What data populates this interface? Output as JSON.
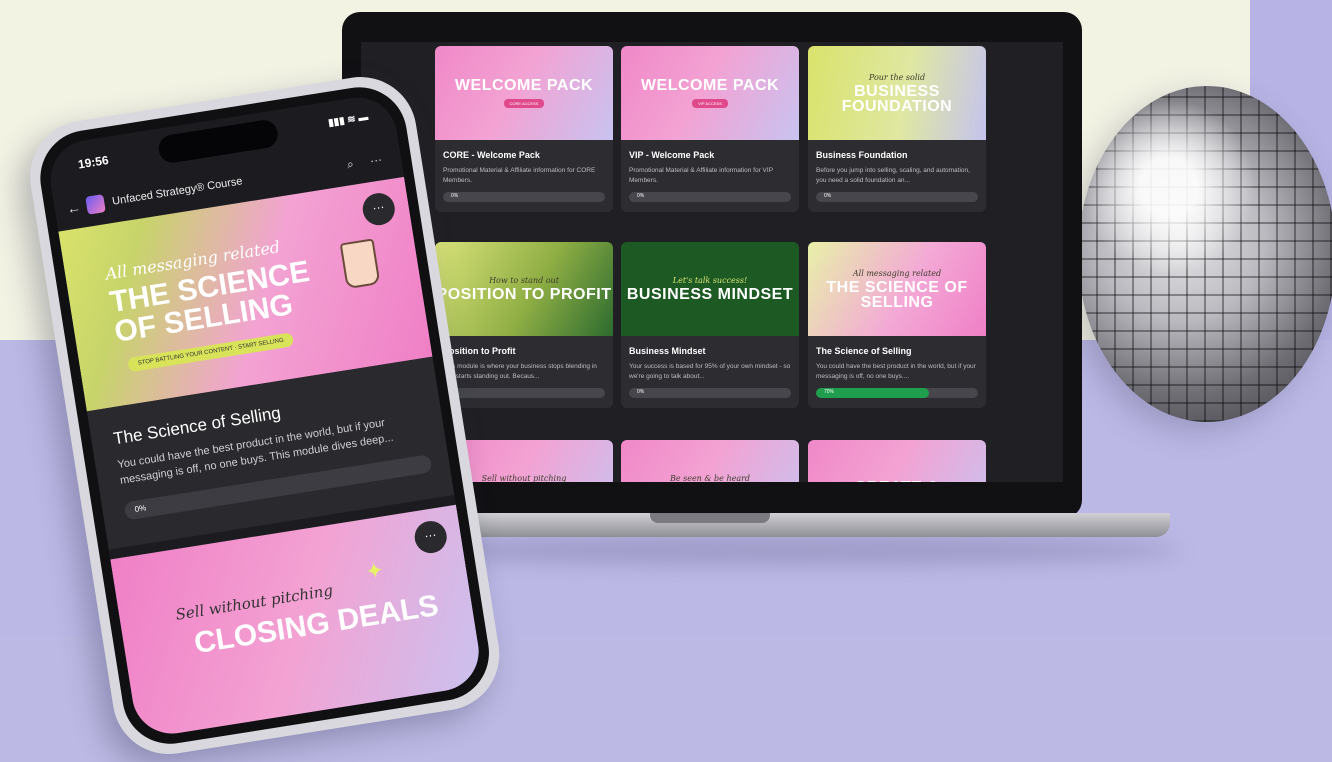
{
  "laptop": {
    "cards": [
      {
        "thumb_script": "",
        "thumb_title": "WELCOME PACK",
        "thumb_pill": "CORE ACCESS",
        "title": "CORE - Welcome Pack",
        "desc": "Promotional Material & Affiliate information for CORE Members.",
        "progress": 0,
        "progress_label": "0%"
      },
      {
        "thumb_script": "",
        "thumb_title": "WELCOME PACK",
        "thumb_pill": "VIP ACCESS",
        "title": "VIP - Welcome Pack",
        "desc": "Promotional Material & Affiliate information for VIP Members.",
        "progress": 0,
        "progress_label": "0%"
      },
      {
        "thumb_script": "Pour the solid",
        "thumb_title": "BUSINESS FOUNDATION",
        "thumb_pill": "",
        "title": "Business Foundation",
        "desc": "Before you jump into selling, scaling, and automation, you need a solid foundation an...",
        "progress": 0,
        "progress_label": "0%"
      },
      {
        "thumb_script": "How to stand out",
        "thumb_title": "POSITION TO PROFIT",
        "thumb_pill": "",
        "title": "Position to Profit",
        "desc": "This module is where your business stops blending in and starts standing out. Becaus...",
        "progress": 0,
        "progress_label": "0%"
      },
      {
        "thumb_script": "Let's talk success!",
        "thumb_title": "BUSINESS MINDSET",
        "thumb_pill": "",
        "title": "Business Mindset",
        "desc": "Your success is based for 95% of your own mindset - so we're going to talk about...",
        "progress": 0,
        "progress_label": "0%"
      },
      {
        "thumb_script": "All messaging related",
        "thumb_title": "THE SCIENCE OF SELLING",
        "thumb_pill": "",
        "title": "The Science of Selling",
        "desc": "You could have the best product in the world, but if your messaging is off, no one buys....",
        "progress": 70,
        "progress_label": "70%"
      },
      {
        "thumb_script": "Sell without pitching",
        "thumb_title": "CLOSING",
        "thumb_pill": "",
        "title": "",
        "desc": "",
        "progress": 0,
        "progress_label": ""
      },
      {
        "thumb_script": "Be seen & be heard",
        "thumb_title": "VISIBILITY",
        "thumb_pill": "",
        "title": "",
        "desc": "",
        "progress": 0,
        "progress_label": ""
      },
      {
        "thumb_script": "",
        "thumb_title": "CREATE &",
        "thumb_pill": "",
        "title": "",
        "desc": "",
        "progress": 0,
        "progress_label": ""
      }
    ]
  },
  "phone": {
    "time": "19:56",
    "signal": "▮▮▮ ≋ ▬",
    "app_title": "Unfaced Strategy® Course",
    "back_icon": "←",
    "search_icon": "⌕",
    "more_icon": "···",
    "hero_script": "All messaging related",
    "hero_title_1": "THE SCIENCE",
    "hero_title_2": "OF SELLING",
    "hero_pill": "STOP BATTLING YOUR CONTENT · START SELLING",
    "module_title": "The Science of Selling",
    "module_desc": "You could have the best product in the world, but if your messaging is off, no one buys. This module dives deep...",
    "progress_label": "0%",
    "next_script": "Sell without pitching",
    "next_title": "CLOSING DEALS"
  },
  "colors": {
    "progress_fill": "#1f9e4d",
    "accent_pink": "#f07fc6",
    "accent_lime": "#d9e36b"
  }
}
